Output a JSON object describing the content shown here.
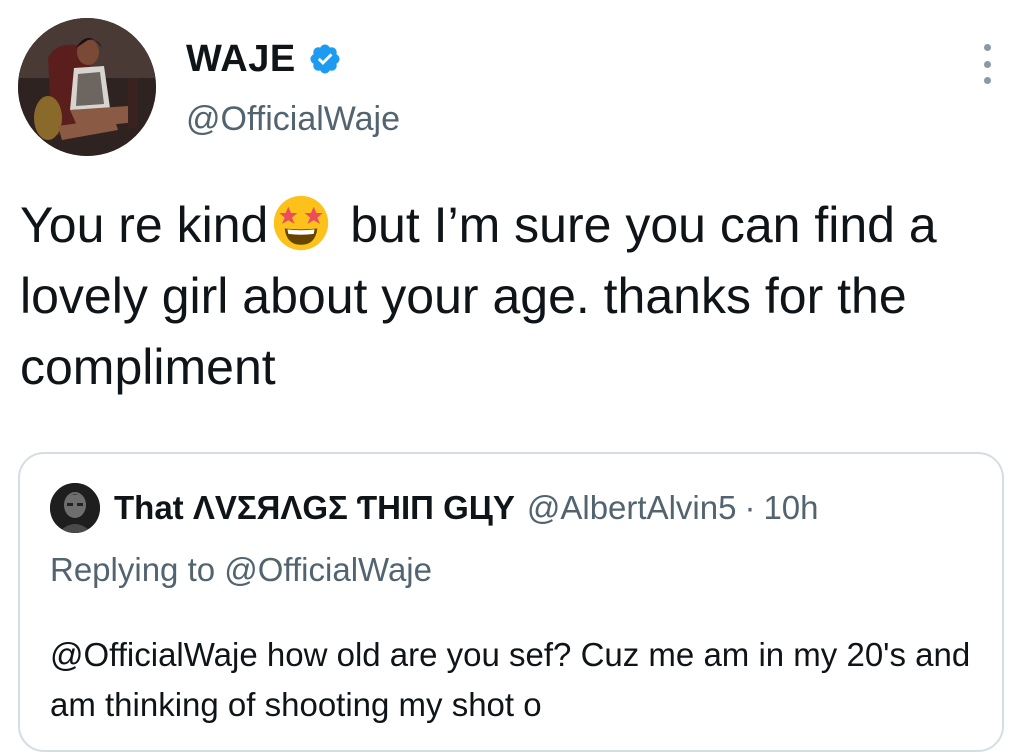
{
  "author": {
    "display_name": "WAJE",
    "handle": "@OfficialWaje",
    "verified": true,
    "avatar_icon": "profile-photo-woman-seated"
  },
  "tweet": {
    "text_part1": "You re kind",
    "emoji": "star-struck-emoji",
    "text_part2": " but I’m sure you can find a lovely girl about your age. thanks for the compliment"
  },
  "quoted_tweet": {
    "display_name": "That ΛVΣЯΛGΣ ƬHIП GЦY",
    "handle": "@AlbertAlvin5",
    "separator": "·",
    "time": "10h",
    "replying_prefix": "Replying to ",
    "replying_to": "@OfficialWaje",
    "text": "@OfficialWaje how old are you sef? Cuz me am in my 20's and am thinking of shooting my shot o"
  },
  "colors": {
    "text_primary": "#0f1419",
    "text_secondary": "#536471",
    "verified_blue": "#1d9bf0",
    "card_border": "#d4dde3"
  }
}
